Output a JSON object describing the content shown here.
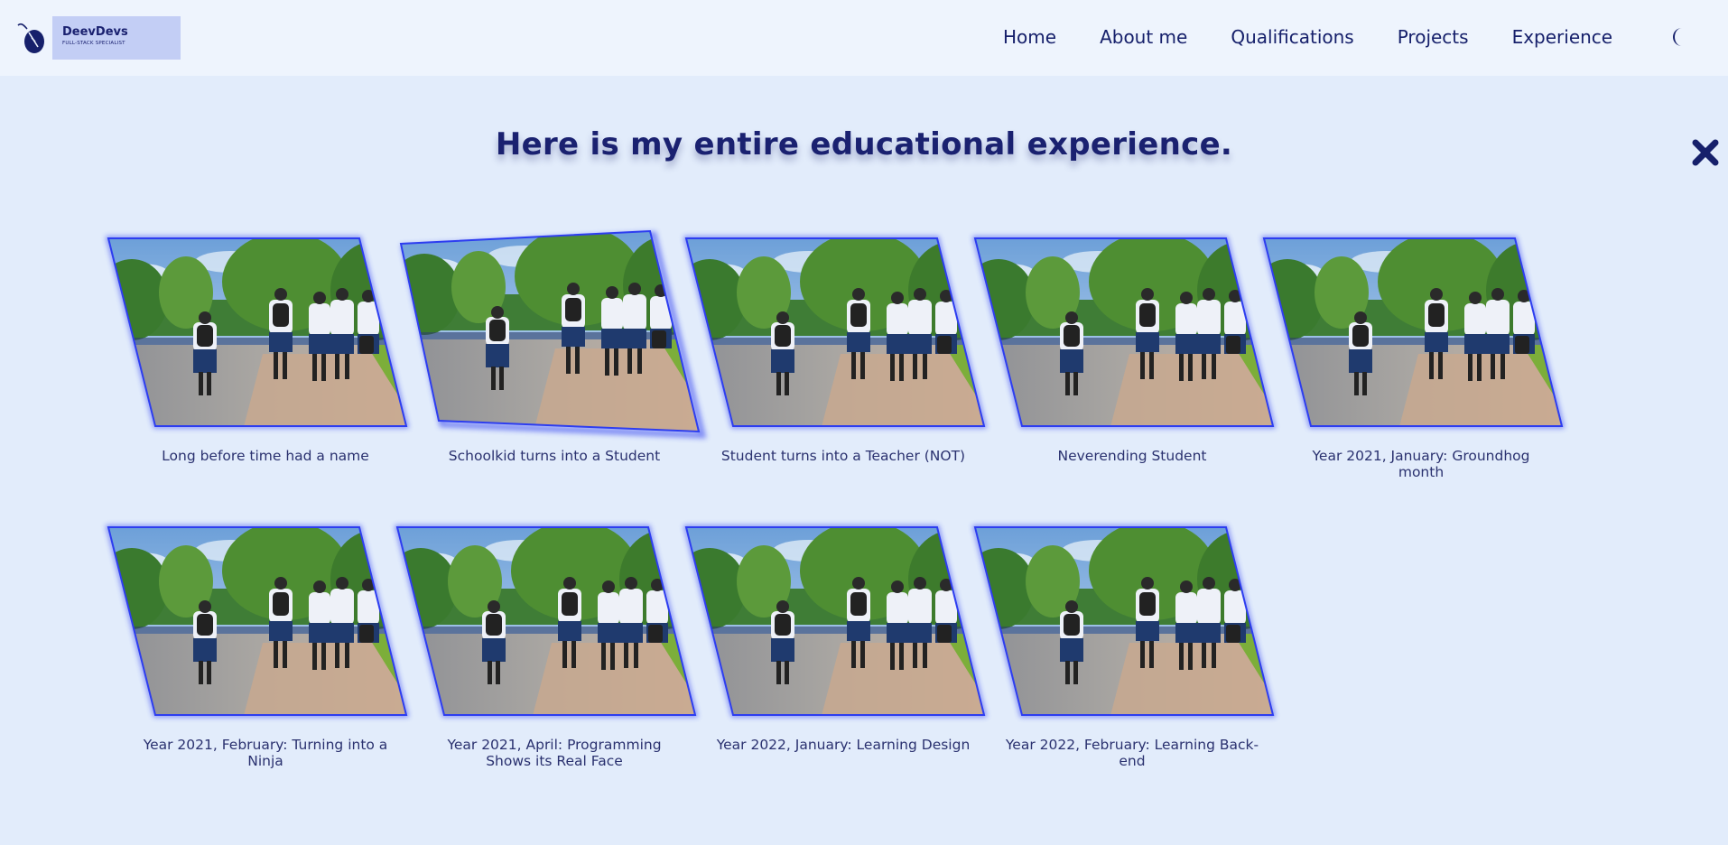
{
  "brand": {
    "name": "DeevDevs",
    "tagline": "FULL-STACK SPECIALIST"
  },
  "nav": {
    "items": [
      {
        "label": "Home"
      },
      {
        "label": "About me"
      },
      {
        "label": "Qualifications"
      },
      {
        "label": "Projects"
      },
      {
        "label": "Experience"
      }
    ]
  },
  "icons": {
    "logo": "mouse-logo-icon",
    "theme": "moon-icon",
    "close": "close-icon"
  },
  "heading": "Here is my entire educational experience.",
  "colors": {
    "page_bg": "#e2ecfb",
    "header_bg": "#eef4fd",
    "brand_box": "#c3cef5",
    "accent": "#2d3df0",
    "text": "#16206b"
  },
  "cards": [
    {
      "caption": "Long before time had a name",
      "image": "students-walking-photo"
    },
    {
      "caption": "Schoolkid turns into a Student",
      "image": "students-walking-photo",
      "hovered": true
    },
    {
      "caption": "Student turns into a Teacher (NOT)",
      "image": "students-walking-photo"
    },
    {
      "caption": "Neverending Student",
      "image": "students-walking-photo"
    },
    {
      "caption": "Year 2021, January: Groundhog month",
      "image": "students-walking-photo"
    },
    {
      "caption": "Year 2021, February: Turning into a Ninja",
      "image": "students-walking-photo"
    },
    {
      "caption": "Year 2021, April: Programming Shows its Real Face",
      "image": "students-walking-photo"
    },
    {
      "caption": "Year 2022, January: Learning Design",
      "image": "students-walking-photo"
    },
    {
      "caption": "Year 2022, February: Learning Back-end",
      "image": "students-walking-photo"
    }
  ]
}
